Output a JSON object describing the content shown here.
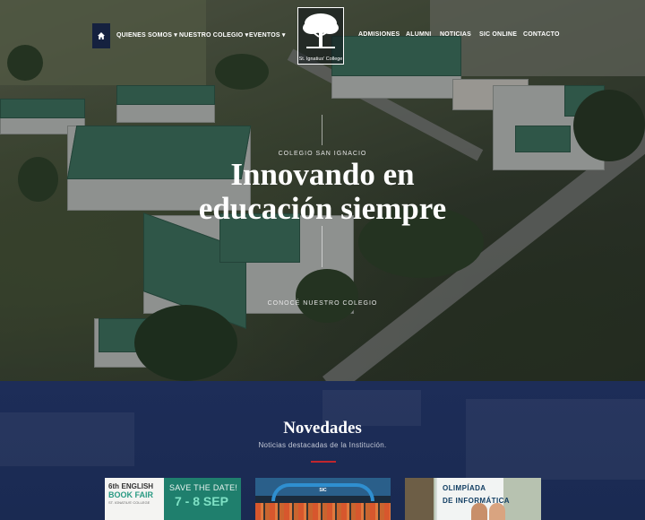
{
  "nav": {
    "left_items": [
      {
        "label": "QUIENES SOMOS"
      },
      {
        "label": "NUESTRO COLEGIO"
      },
      {
        "label": "EVENTOS"
      }
    ],
    "right_items": [
      {
        "label": "ADMISIONES"
      },
      {
        "label": "ALUMNI"
      },
      {
        "label": "NOTICIAS"
      },
      {
        "label": "SIC ONLINE"
      },
      {
        "label": "CONTACTO"
      }
    ],
    "caret": "▾",
    "logo_caption": "St. Ignatius' College"
  },
  "hero": {
    "kicker": "COLEGIO SAN IGNACIO",
    "headline_line1": "Innovando en",
    "headline_line2": "educación siempre",
    "cta": "CONOCÉ NUESTRO COLEGIO"
  },
  "news": {
    "title": "Novedades",
    "subtitle": "Noticias destacadas de la Institución.",
    "cards": [
      {
        "line1": "6th",
        "line1b": "ENGLISH",
        "line2": "BOOK FAIR",
        "line3": "ST. IGNATIUS' COLLEGE",
        "save": "SAVE THE DATE!",
        "date": "7 - 8 SEP"
      },
      {
        "logo": "SIC"
      },
      {
        "line1": "OLIMPÍADA",
        "line2": "DE INFORMÁTICA"
      }
    ]
  },
  "colors": {
    "nav_bg": "#15213f",
    "news_bg": "#1d2d58",
    "accent_red": "#c0262d",
    "roof_green": "#3f7d63"
  }
}
